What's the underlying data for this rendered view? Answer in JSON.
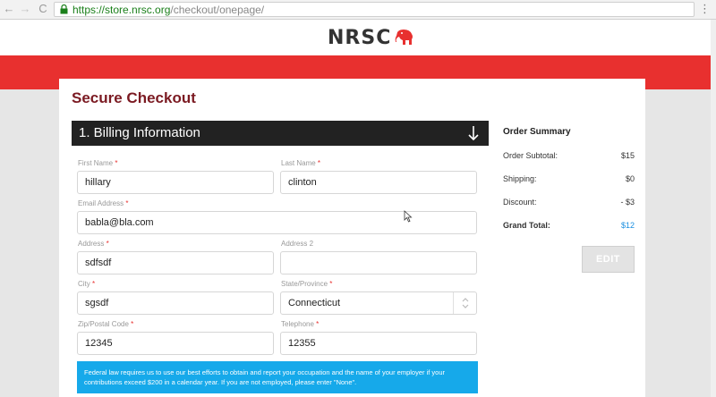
{
  "browser": {
    "url_scheme": "https://",
    "url_host": "store.nrsc.org",
    "url_path": "/checkout/onepage/",
    "menu_glyph": "⋮",
    "back_glyph": "←",
    "forward_glyph": "→",
    "reload_glyph": "C"
  },
  "site": {
    "logo_text": "NRSC",
    "brand_red": "#e8302f"
  },
  "page": {
    "title": "Secure Checkout"
  },
  "billing": {
    "section_title": "1. Billing Information",
    "required_mark": "*",
    "fields": {
      "first_name": {
        "label": "First Name",
        "value": "hillary"
      },
      "last_name": {
        "label": "Last Name",
        "value": "clinton"
      },
      "email": {
        "label": "Email Address",
        "value": "babla@bla.com"
      },
      "address": {
        "label": "Address",
        "value": "sdfsdf"
      },
      "address2": {
        "label": "Address 2",
        "value": ""
      },
      "city": {
        "label": "City",
        "value": "sgsdf"
      },
      "state": {
        "label": "State/Province",
        "value": "Connecticut"
      },
      "zip": {
        "label": "Zip/Postal Code",
        "value": "12345"
      },
      "telephone": {
        "label": "Telephone",
        "value": "12355"
      }
    },
    "notice": "Federal law requires us to use our best efforts to obtain and report your occupation and the name of your employer if your contributions exceed $200 in a calendar year. If you are not employed, please enter \"None\"."
  },
  "summary": {
    "title": "Order Summary",
    "subtotal_label": "Order Subtotal:",
    "subtotal_value": "$15",
    "shipping_label": "Shipping:",
    "shipping_value": "$0",
    "discount_label": "Discount:",
    "discount_value": "- $3",
    "grand_label": "Grand Total:",
    "grand_value": "$12",
    "edit_label": "EDIT",
    "accent_color": "#1a8fe0"
  }
}
